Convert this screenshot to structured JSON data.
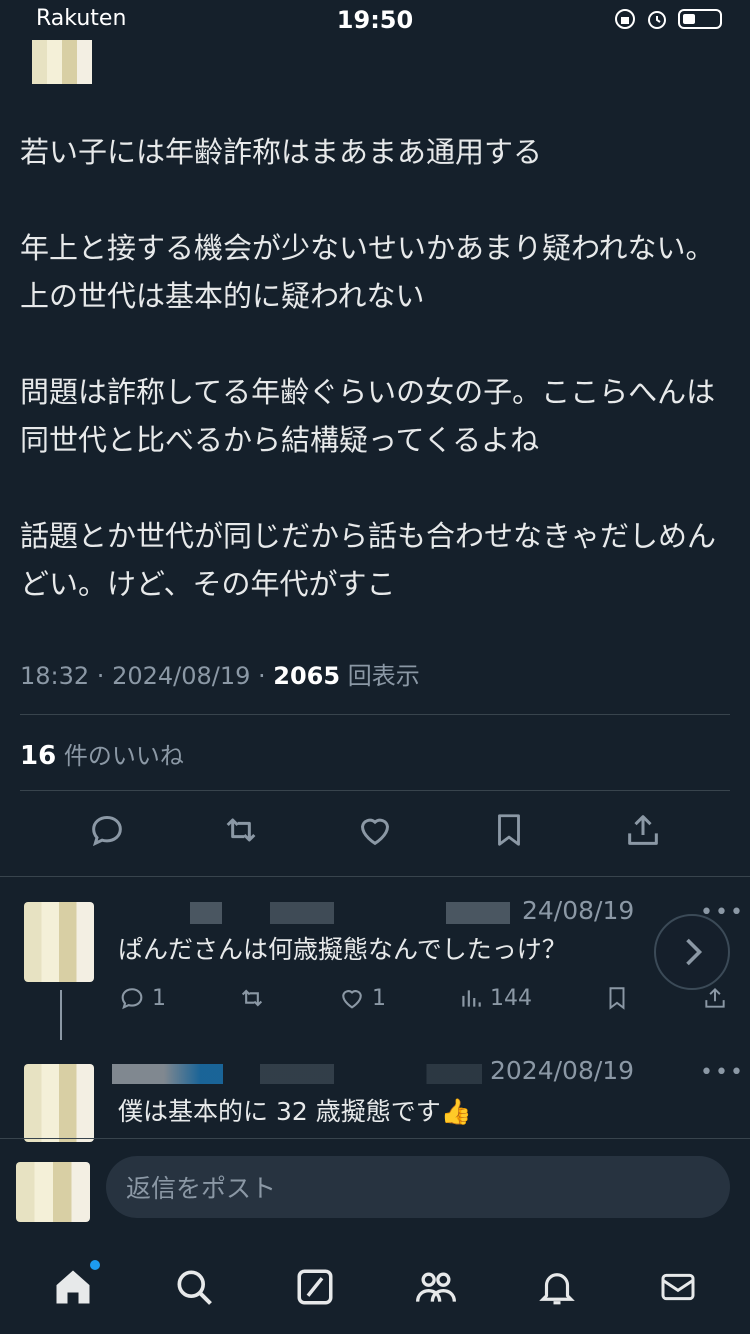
{
  "status_bar": {
    "carrier": "Rakuten",
    "time": "19:50"
  },
  "tweet": {
    "paragraphs": [
      "若い子には年齢詐称はまあまあ通用する",
      "年上と接する機会が少ないせいかあまり疑われない。上の世代は基本的に疑われない",
      "問題は詐称してる年齢ぐらいの女の子。ここらへんは同世代と比べるから結構疑ってくるよね",
      "話題とか世代が同じだから話も合わせなきゃだしめんどい。けど、その年代がすこ"
    ],
    "time": "18:32",
    "date": "2024/08/19",
    "views_count": "2065",
    "views_label": "回表示",
    "likes_count": "16",
    "likes_label": "件のいいね"
  },
  "reply1": {
    "date": "24/08/19",
    "text": "ぱんださんは何歳擬態なんでしたっけ？",
    "replies": "1",
    "likes": "1",
    "views": "144",
    "more": "•••"
  },
  "reply2": {
    "date": "2024/08/19",
    "text": "僕は基本的に 32 歳擬態です👍",
    "more": "•••"
  },
  "composer": {
    "placeholder": "返信をポスト"
  },
  "icons": {
    "reply": "comment-icon",
    "retweet": "retweet-icon",
    "like": "heart-icon",
    "bookmark": "bookmark-icon",
    "share": "share-icon",
    "home": "home-icon",
    "search": "search-icon",
    "grok": "grok-icon",
    "communities": "communities-icon",
    "notifications": "bell-icon",
    "messages": "mail-icon"
  },
  "colors": {
    "background": "#15202b",
    "accent": "#1d9bf0",
    "muted": "#8b98a5"
  }
}
